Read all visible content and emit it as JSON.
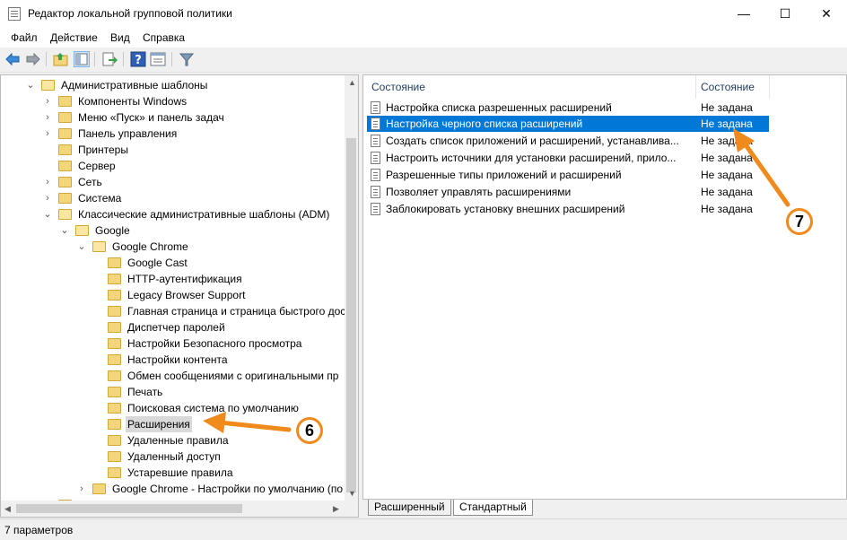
{
  "window": {
    "title": "Редактор локальной групповой политики",
    "controls": {
      "minimize": "—",
      "maximize": "☐",
      "close": "✕"
    }
  },
  "menu": [
    "Файл",
    "Действие",
    "Вид",
    "Справка"
  ],
  "toolbar": {
    "icons": [
      "back-arrow-icon",
      "forward-arrow-icon",
      "up-folder-icon",
      "show-hide-tree-icon",
      "export-list-icon",
      "help-icon",
      "properties-icon",
      "filter-icon"
    ]
  },
  "tree": {
    "items": [
      {
        "label": "Административные шаблоны",
        "expander": "⌄"
      },
      {
        "label": "Компоненты Windows",
        "expander": "›"
      },
      {
        "label": "Меню «Пуск» и панель задач",
        "expander": "›"
      },
      {
        "label": "Панель управления",
        "expander": "›"
      },
      {
        "label": "Принтеры",
        "expander": ""
      },
      {
        "label": "Сервер",
        "expander": ""
      },
      {
        "label": "Сеть",
        "expander": "›"
      },
      {
        "label": "Система",
        "expander": "›"
      },
      {
        "label": "Классические административные шаблоны (ADM)",
        "expander": "⌄"
      },
      {
        "label": "Google",
        "expander": "⌄"
      },
      {
        "label": "Google Chrome",
        "expander": "⌄"
      },
      {
        "label": "Google Cast",
        "expander": ""
      },
      {
        "label": "HTTP-аутентификация",
        "expander": ""
      },
      {
        "label": "Legacy Browser Support",
        "expander": ""
      },
      {
        "label": "Главная страница и страница быстрого дост",
        "expander": ""
      },
      {
        "label": "Диспетчер паролей",
        "expander": ""
      },
      {
        "label": "Настройки Безопасного просмотра",
        "expander": ""
      },
      {
        "label": "Настройки контента",
        "expander": ""
      },
      {
        "label": "Обмен сообщениями с оригинальными пр",
        "expander": ""
      },
      {
        "label": "Печать",
        "expander": ""
      },
      {
        "label": "Поисковая система по умолчанию",
        "expander": ""
      },
      {
        "label": "Расширения",
        "expander": ""
      },
      {
        "label": "Удаленные правила",
        "expander": ""
      },
      {
        "label": "Удаленный доступ",
        "expander": ""
      },
      {
        "label": "Устаревшие правила",
        "expander": ""
      },
      {
        "label": "Google Chrome - Настройки по умолчанию (по",
        "expander": "›"
      }
    ],
    "selected_index": 21
  },
  "settings": {
    "columns": [
      "Состояние",
      "Состояние"
    ],
    "rows": [
      {
        "name": "Настройка списка разрешенных расширений",
        "state": "Не задана"
      },
      {
        "name": "Настройка черного списка расширений",
        "state": "Не задана"
      },
      {
        "name": "Создать список приложений и расширений, устанавлива...",
        "state": "Не задана"
      },
      {
        "name": "Настроить источники для установки расширений, прило...",
        "state": "Не задана"
      },
      {
        "name": "Разрешенные типы приложений и расширений",
        "state": "Не задана"
      },
      {
        "name": "Позволяет управлять расширениями",
        "state": "Не задана"
      },
      {
        "name": "Заблокировать установку внешних расширений",
        "state": "Не задана"
      }
    ],
    "selected_index": 1
  },
  "tabs": [
    "Расширенный",
    "Стандартный"
  ],
  "active_tab": "Стандартный",
  "status": "7 параметров",
  "annotations": {
    "callout_tree": "6",
    "callout_list": "7",
    "color": "#f08a1c"
  },
  "colors": {
    "selection": "#0078d7",
    "tree_selection": "#d9d9d9"
  }
}
